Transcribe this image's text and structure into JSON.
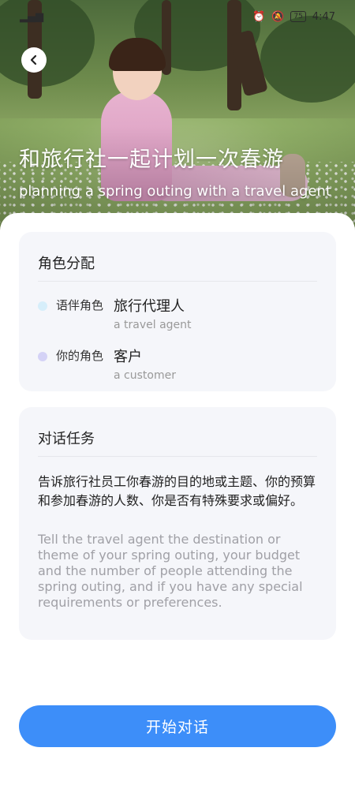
{
  "status_bar": {
    "time": "4:47",
    "battery": "75"
  },
  "hero": {
    "title": "和旅行社一起计划一次春游",
    "subtitle": "planning a spring outing with a travel agent"
  },
  "roles": {
    "title": "角色分配",
    "partner": {
      "label": "语伴角色",
      "value": "旅行代理人",
      "english": "a travel agent",
      "dot_color": "#d6eefa"
    },
    "user": {
      "label": "你的角色",
      "value": "客户",
      "english": "a customer",
      "dot_color": "#d4d2f6"
    }
  },
  "task": {
    "title": "对话任务",
    "chinese": "告诉旅行社员工你春游的目的地或主题、你的预算和参加春游的人数、你是否有特殊要求或偏好。",
    "english": "Tell the travel agent the destination or theme of your spring outing, your budget and the number of people attending the spring outing, and if you have any special requirements or preferences."
  },
  "start_button": {
    "label": "开始对话"
  },
  "colors": {
    "accent": "#3d8ef9",
    "card_bg": "#f5f6fa"
  },
  "icons": {
    "back": "chevron-left-icon"
  }
}
